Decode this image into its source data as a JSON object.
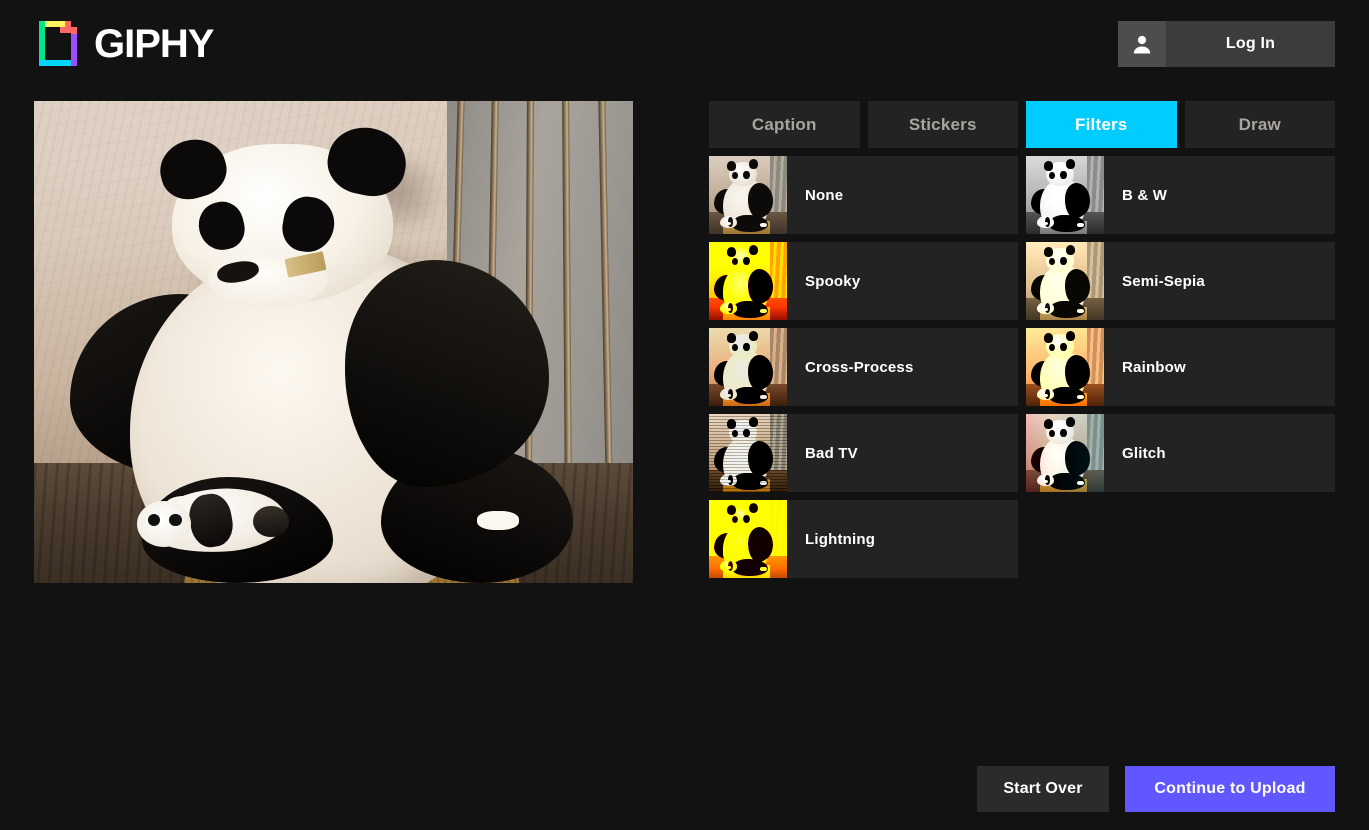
{
  "header": {
    "brand_name": "GIPHY",
    "logo_icon": "giphy-logo-icon",
    "login": {
      "label": "Log In",
      "icon": "person-icon"
    }
  },
  "preview": {
    "alt": "Giant panda sitting eating with cub lying on straw",
    "media_type": "gif-preview"
  },
  "editor": {
    "tabs": [
      {
        "label": "Caption",
        "active": false
      },
      {
        "label": "Stickers",
        "active": false
      },
      {
        "label": "Filters",
        "active": true
      },
      {
        "label": "Draw",
        "active": false
      }
    ],
    "active_tab": "Filters",
    "filters": [
      {
        "label": "None",
        "fx": "fx-none"
      },
      {
        "label": "B & W",
        "fx": "fx-bw"
      },
      {
        "label": "Spooky",
        "fx": "fx-spooky"
      },
      {
        "label": "Semi-Sepia",
        "fx": "fx-semisepia"
      },
      {
        "label": "Cross-Process",
        "fx": "fx-cross"
      },
      {
        "label": "Rainbow",
        "fx": "fx-rainbow"
      },
      {
        "label": "Bad TV",
        "fx": "fx-badtv"
      },
      {
        "label": "Glitch",
        "fx": "fx-glitch"
      },
      {
        "label": "Lightning",
        "fx": "fx-lightning"
      }
    ]
  },
  "footer": {
    "start_over_label": "Start Over",
    "continue_label": "Continue to Upload"
  },
  "colors": {
    "page_background": "#121212",
    "panel_surface": "#232323",
    "accent_active_tab": "#00ccff",
    "accent_primary_button": "#6157ff",
    "secondary_button": "#2b2b2b",
    "text_primary": "#ffffff",
    "text_muted": "#a8a49e",
    "login_button": "#3c3c3c",
    "login_icon_box": "#4d4d4d"
  }
}
